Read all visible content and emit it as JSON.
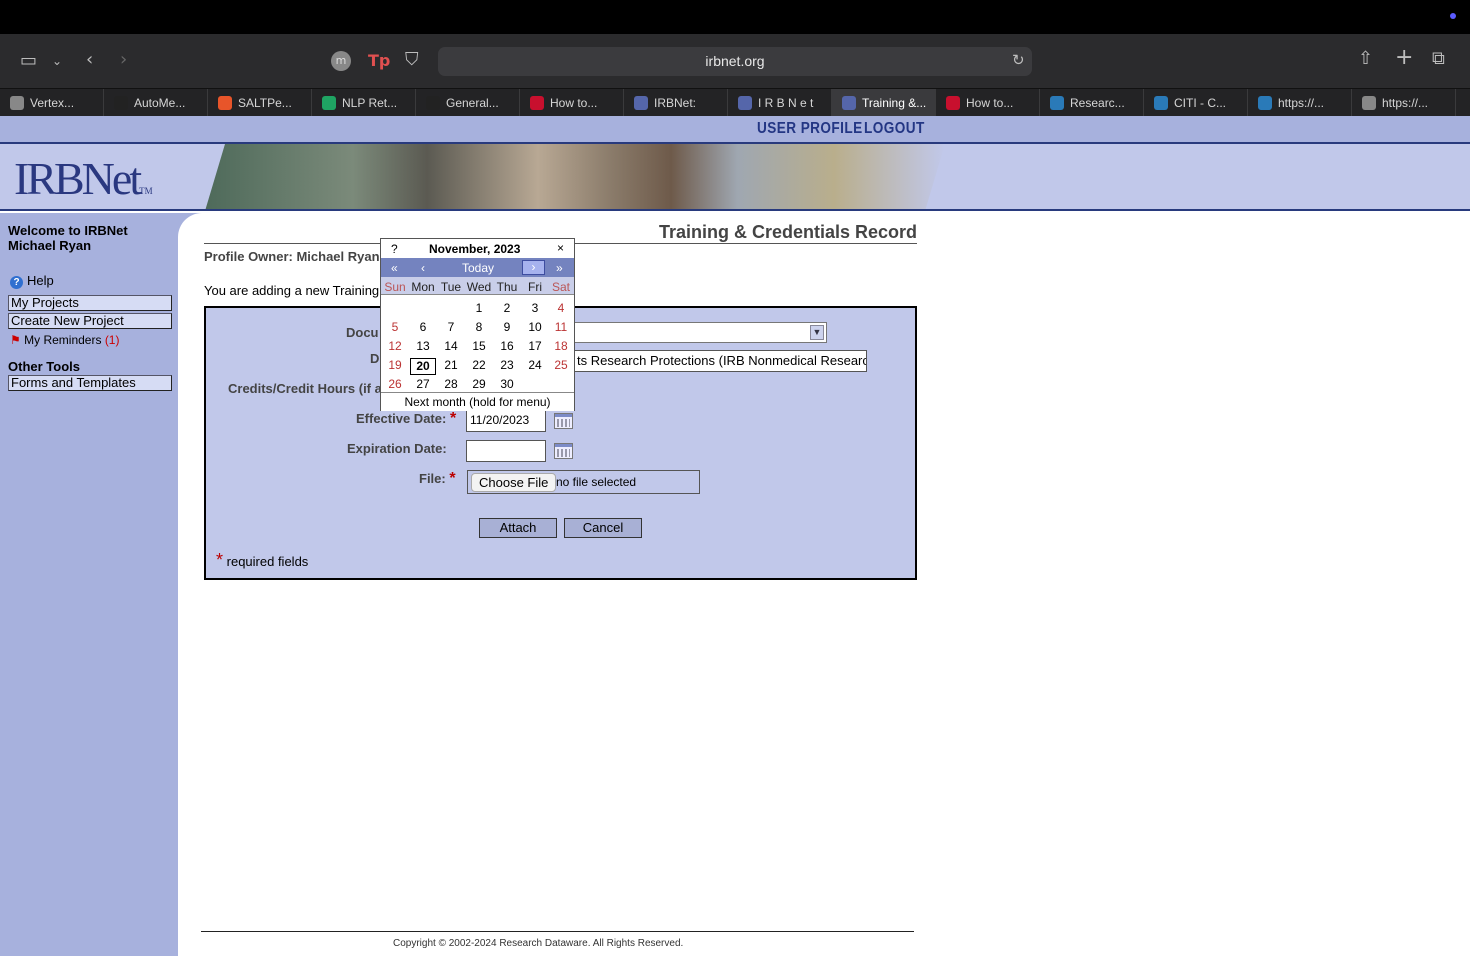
{
  "browser": {
    "url": "irbnet.org",
    "tabs": [
      {
        "label": "Vertex...",
        "icon": "gear-icon",
        "color": "#888888"
      },
      {
        "label": "AutoMe...",
        "icon": "auto-icon",
        "color": "#222222"
      },
      {
        "label": "SALTPe...",
        "icon": "fire-icon",
        "color": "#e8552a"
      },
      {
        "label": "NLP Ret...",
        "icon": "sheets-icon",
        "color": "#1fa463"
      },
      {
        "label": "General...",
        "icon": "github-icon",
        "color": "#222222"
      },
      {
        "label": "How to...",
        "icon": "umd-icon",
        "color": "#c8102e"
      },
      {
        "label": "IRBNet:",
        "icon": "irbnet-icon",
        "color": "#5566aa"
      },
      {
        "label": "I R B N e t",
        "icon": "irbnet-icon",
        "color": "#5566aa"
      },
      {
        "label": "Training &...",
        "icon": "irbnet-icon",
        "color": "#5566aa",
        "active": true
      },
      {
        "label": "How to...",
        "icon": "umd-icon",
        "color": "#c8102e"
      },
      {
        "label": "Researc...",
        "icon": "citi-icon",
        "color": "#2a7ab8"
      },
      {
        "label": "CITI - C...",
        "icon": "citi-icon",
        "color": "#2a7ab8"
      },
      {
        "label": "https://...",
        "icon": "citi-icon",
        "color": "#2a7ab8"
      },
      {
        "label": "https://...",
        "icon": "citi-icon",
        "color": "#888888"
      }
    ]
  },
  "nav": {
    "user_profile": "USER PROFILE",
    "logout": "LOGOUT"
  },
  "logo": {
    "text": "IRBNet",
    "tm": "TM"
  },
  "sidebar": {
    "welcome": "Welcome to IRBNet",
    "user": "Michael Ryan",
    "help": "Help",
    "my_projects": "My Projects",
    "create_project": "Create New Project",
    "reminders": "My Reminders",
    "reminders_count": "(1)",
    "other_tools": "Other Tools",
    "forms": "Forms and Templates"
  },
  "main": {
    "title": "Training & Credentials Record",
    "owner": "Profile Owner: Michael Ryan",
    "adding": "You are adding a new Training",
    "labels": {
      "document": "Docu",
      "description": "D",
      "credits": "Credits/Credit Hours (if a",
      "effective": "Effective Date:",
      "expiration": "Expiration Date:",
      "file": "File:"
    },
    "description_value": "ts Research Protections (IRB Nonmedical Research) F",
    "effective_value": "11/20/2023",
    "expiration_value": "",
    "file_button": "Choose File",
    "file_status": "no file selected",
    "attach": "Attach",
    "cancel": "Cancel",
    "required_note": "required fields",
    "required_mark": "*"
  },
  "calendar": {
    "help": "?",
    "title": "November, 2023",
    "close": "×",
    "prev_year": "«",
    "prev_month": "‹",
    "today": "Today",
    "next_month": "›",
    "next_year": "»",
    "days": [
      "Sun",
      "Mon",
      "Tue",
      "Wed",
      "Thu",
      "Fri",
      "Sat"
    ],
    "weeks": [
      [
        "",
        "",
        "",
        "1",
        "2",
        "3",
        "4"
      ],
      [
        "5",
        "6",
        "7",
        "8",
        "9",
        "10",
        "11"
      ],
      [
        "12",
        "13",
        "14",
        "15",
        "16",
        "17",
        "18"
      ],
      [
        "19",
        "20",
        "21",
        "22",
        "23",
        "24",
        "25"
      ],
      [
        "26",
        "27",
        "28",
        "29",
        "30",
        "",
        ""
      ]
    ],
    "selected_day": "20",
    "status": "Next month (hold for menu)"
  },
  "footer": "Copyright © 2002-2024 Research Dataware. All Rights Reserved."
}
